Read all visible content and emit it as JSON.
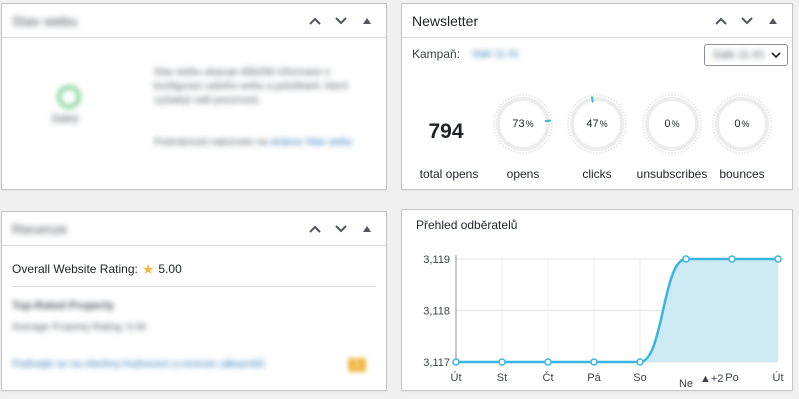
{
  "left_top_box": {
    "title": "Stav webu",
    "icon_label": "Dobrý",
    "text1": "Stav webu ukazuje důležité informace o konfiguraci vašeho webu a položkách, které vyžadují vaši pozornost.",
    "text2": "Podrobnosti naleznete na",
    "link": "stránce Stav webu"
  },
  "newsletter": {
    "title": "Newsletter",
    "campaign_label": "Kampaň:",
    "campaign_value": "Sale 11 #1",
    "select_value": "Sale 11 #1",
    "total_value": "794",
    "total_label": "total opens",
    "stats": [
      {
        "label": "opens",
        "value": "73",
        "pct": "%",
        "fraction": 0.73
      },
      {
        "label": "clicks",
        "value": "47",
        "pct": "%",
        "fraction": 0.47
      },
      {
        "label": "unsubscribes",
        "value": "0",
        "pct": "%",
        "fraction": 0
      },
      {
        "label": "bounces",
        "value": "0",
        "pct": "%",
        "fraction": 0
      }
    ],
    "accent": "#38b6e0"
  },
  "rating_box": {
    "title": "Recenze",
    "rating_label": "Overall Website Rating:",
    "rating_value": "5.00",
    "sub_title": "Top-Rated Property",
    "sub_text": "Average Property Rating: 5.00",
    "link": "Podívejte se na všechny hodnocení a recenze zákazníků",
    "badge": "1"
  },
  "subscribers_chart": {
    "title": "Přehled odběratelů",
    "annotation": "▲+2",
    "chart_data": {
      "type": "area",
      "categories": [
        "Út",
        "St",
        "Čt",
        "Pá",
        "So",
        "Ne",
        "Po",
        "Út"
      ],
      "values": [
        3117,
        3117,
        3117,
        3117,
        3117,
        3119,
        3119,
        3119
      ],
      "y_ticks": [
        "3,117",
        "3,118",
        "3,119"
      ],
      "ylim": [
        3117,
        3119
      ],
      "grid": true,
      "line_color": "#38b6e0",
      "fill_color": "#cdeaf5"
    }
  }
}
